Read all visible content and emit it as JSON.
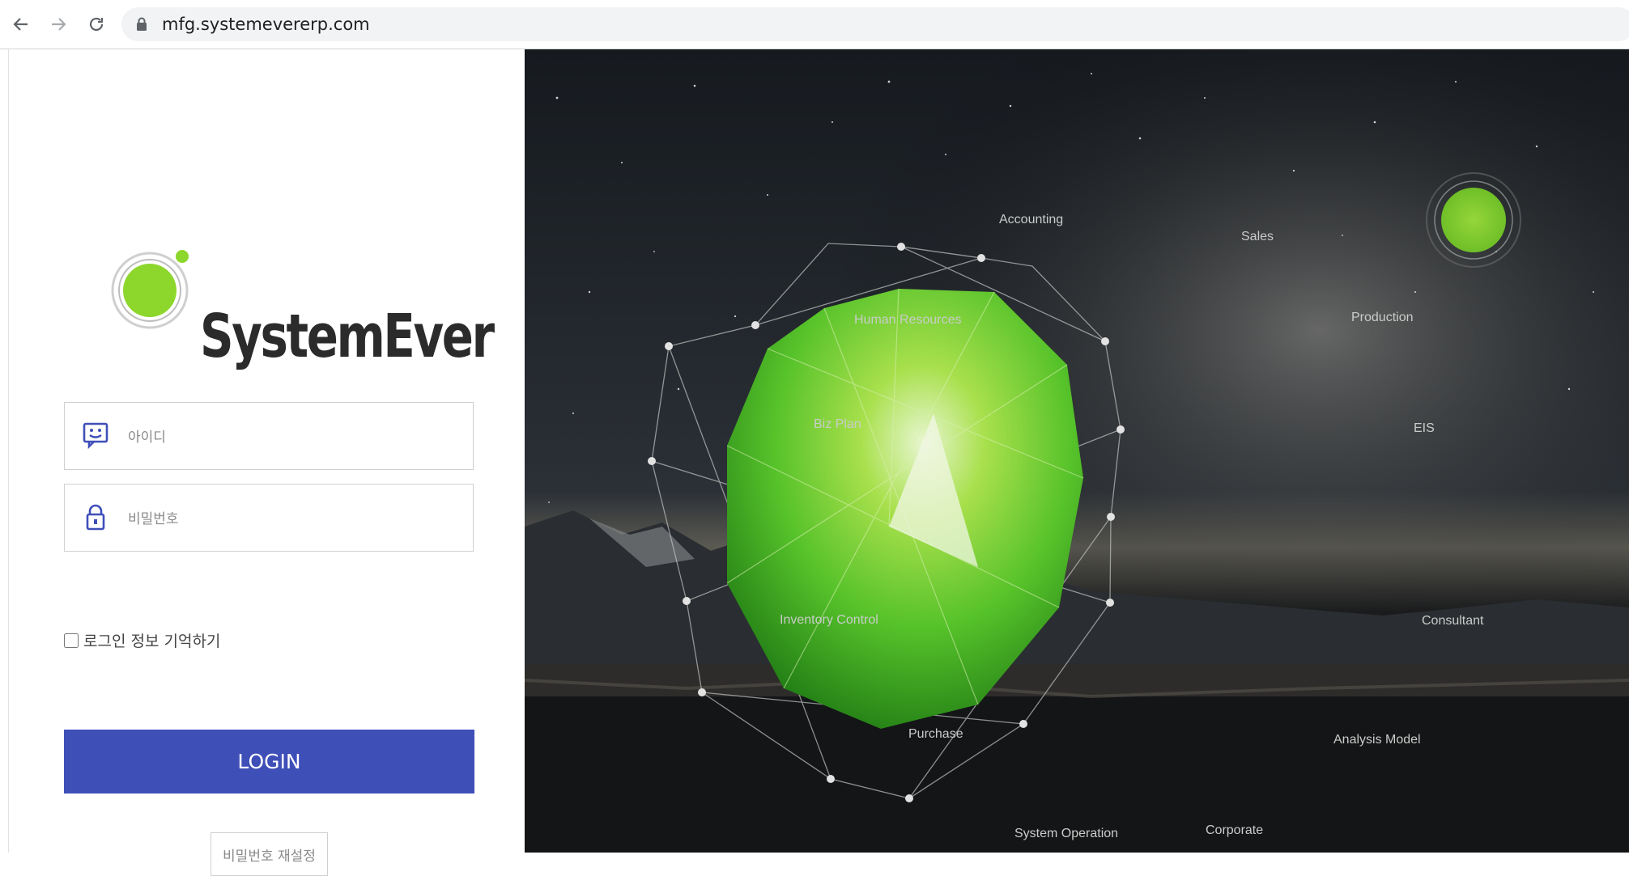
{
  "browser": {
    "url": "mfg.systemevererp.com",
    "back_icon": "arrow-left-icon",
    "forward_icon": "arrow-right-icon",
    "reload_icon": "reload-icon",
    "secure_icon": "lock-icon"
  },
  "login": {
    "brand": "SystemEver",
    "id_placeholder": "아이디",
    "password_placeholder": "비밀번호",
    "remember_label": "로그인 정보 기억하기",
    "login_button": "LOGIN",
    "reset_password_button": "비밀번호 재설정",
    "accent_color": "#3f4fb8",
    "brand_green": "#8dd62c"
  },
  "hero": {
    "modules": {
      "accounting": "Accounting",
      "sales": "Sales",
      "human_resources": "Human Resources",
      "production": "Production",
      "biz_plan": "Biz Plan",
      "eis": "EIS",
      "inventory_control": "Inventory Control",
      "consultant": "Consultant",
      "purchase": "Purchase",
      "analysis_model": "Analysis Model",
      "system_operation": "System Operation",
      "corporate": "Corporate"
    }
  }
}
